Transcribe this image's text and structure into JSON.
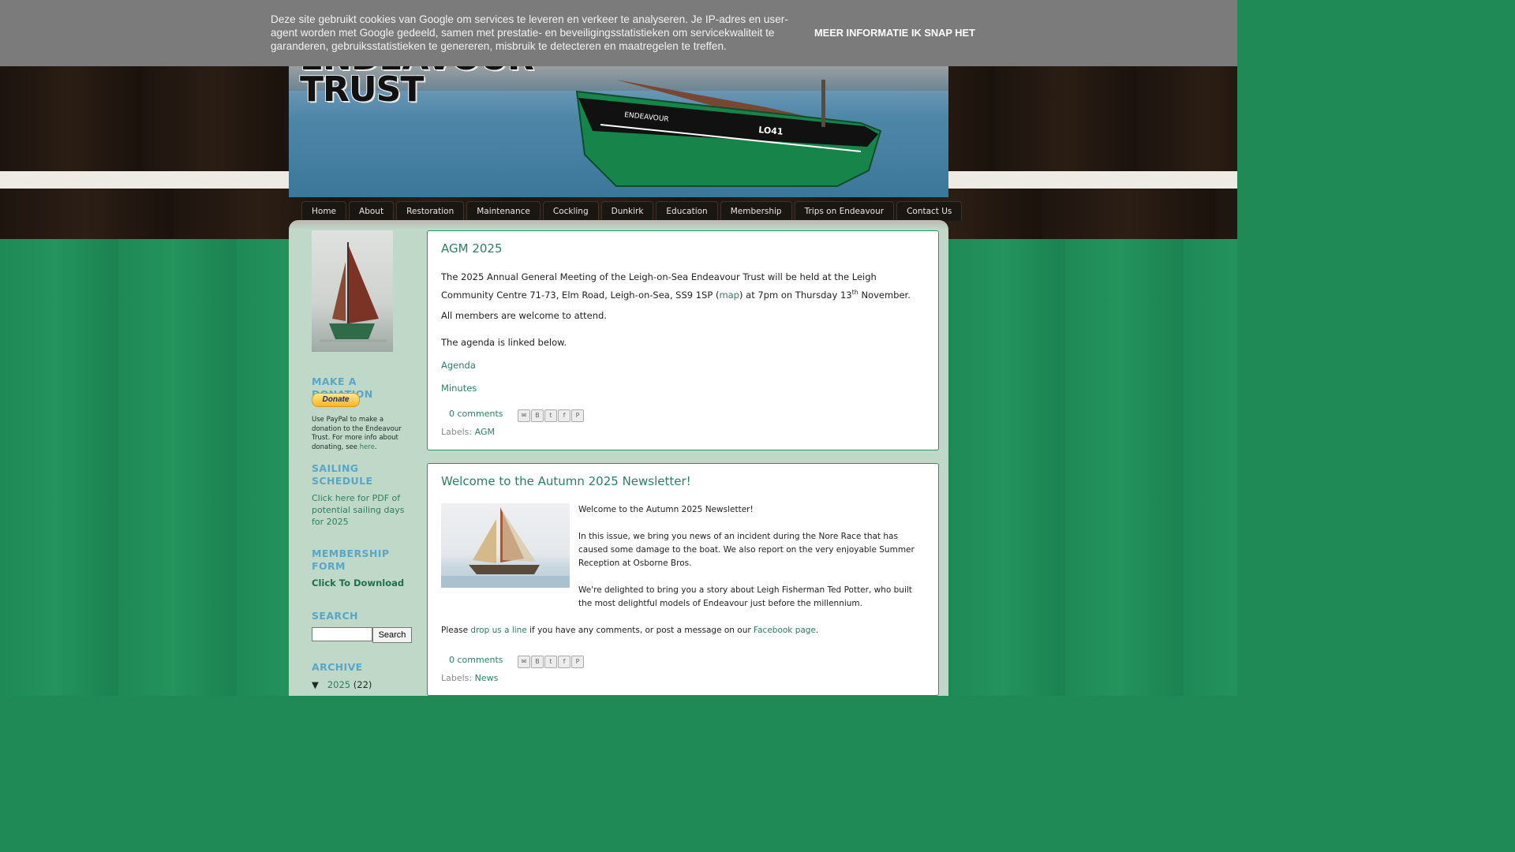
{
  "cookie": {
    "text": "Deze site gebruikt cookies van Google om services te leveren en verkeer te analyseren. Je IP-adres en user-agent worden met Google gedeeld, samen met prestatie- en beveiligingsstatistieken om servicekwaliteit te garanderen, gebruiksstatistieken te genereren, misbruik te detecteren en maatregelen te treffen.",
    "more_label": "MEER INFORMATIE",
    "ok_label": "IK SNAP HET"
  },
  "header": {
    "title_line1": "ENDEAVOUR",
    "title_line2": "TRUST",
    "boat_name": "ENDEAVOUR",
    "boat_reg": "LO41"
  },
  "nav": {
    "tabs": [
      "Home",
      "About",
      "Restoration",
      "Maintenance",
      "Cockling",
      "Dunkirk",
      "Education",
      "Membership",
      "Trips on Endeavour",
      "Contact Us"
    ]
  },
  "sidebar": {
    "donation_heading": "MAKE A DONATION",
    "donate_button": "Donate",
    "donation_text": "Use PayPal to make a donation to the Endeavour Trust. For more info about donating, see ",
    "donation_link": "here",
    "donation_end": ".",
    "sailing_heading": "SAILING SCHEDULE",
    "sailing_link": "Click here for PDF of potential sailing days for 2025",
    "membership_heading": "MEMBERSHIP FORM",
    "membership_link": "Click To Download",
    "search_heading": "SEARCH",
    "search_button": "Search",
    "archive_heading": "ARCHIVE",
    "archive_toggle": "▼",
    "archive_year": "2025",
    "archive_count": "(22)"
  },
  "posts": [
    {
      "title": "AGM 2025",
      "p1_a": "The 2025 Annual General Meeting of the Leigh-on-Sea Endeavour Trust will be held at the Leigh Community Centre 71-73, Elm Road, Leigh-on-Sea, SS9 1SP (",
      "p1_link": "map",
      "p1_b": ") at 7pm on Thursday 13",
      "p1_sup": "th",
      "p1_c": " November.",
      "p2": "All members are welcome to attend.",
      "p3": "The agenda is linked below.",
      "link_agenda": "Agenda",
      "link_minutes": "Minutes",
      "comments": "0 comments",
      "labels_prefix": "Labels:",
      "label": "AGM"
    },
    {
      "title": "Welcome to the Autumn 2025 Newsletter!",
      "p1": "Welcome to the Autumn 2025 Newsletter!",
      "p2": "In this issue, we bring you news of an incident during the Nore Race that has caused some damage to the boat. We also report on the very enjoyable Summer Reception at Osborne Bros.",
      "p3": "We're delighted to bring you a story about Leigh Fisherman Ted Potter, who built the most delightful models of Endeavour just before the millennium.",
      "p4_a": "Please ",
      "p4_link1": "drop us a line",
      "p4_b": " if you have any comments, or post a message on our ",
      "p4_link2": "Facebook page",
      "p4_c": ".",
      "comments": "0 comments",
      "labels_prefix": "Labels:",
      "label": "News"
    }
  ],
  "share_icons": [
    "email-icon",
    "blogthis-icon",
    "twitter-icon",
    "facebook-icon",
    "pinterest-icon"
  ],
  "colors": {
    "accent": "#2c7f61",
    "heading_blue": "#5aa6c7",
    "page_green": "#1f8a55",
    "cookie_bg": "#7b7b7b"
  }
}
